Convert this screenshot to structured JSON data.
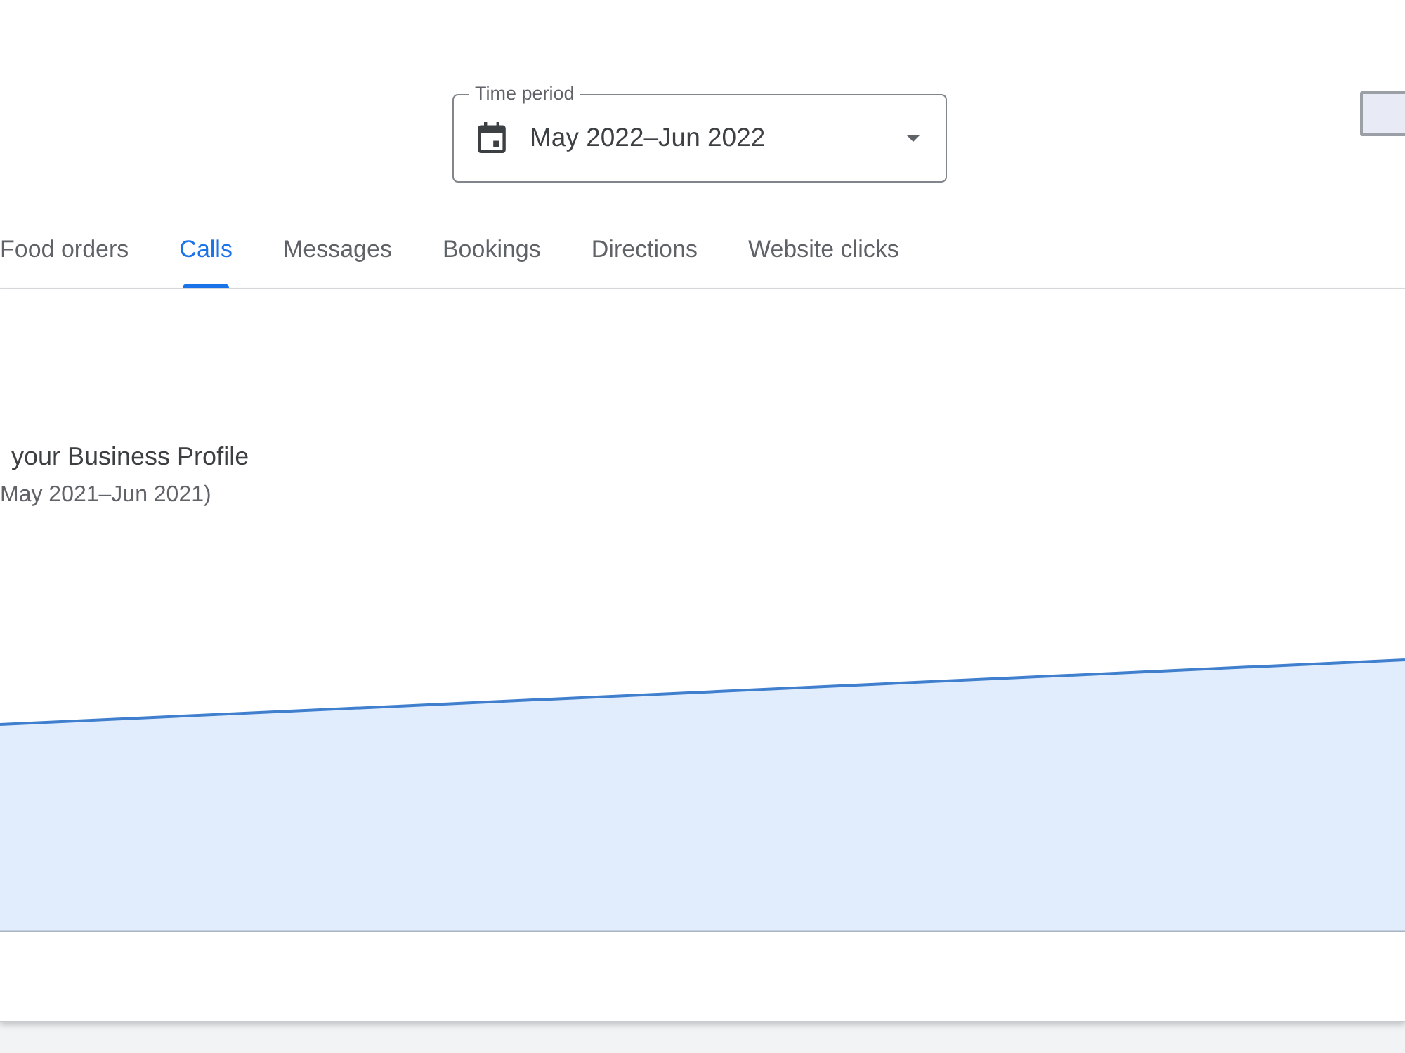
{
  "time_period": {
    "label": "Time period",
    "value": "May 2022–Jun 2022"
  },
  "tabs": [
    {
      "label": "Food orders",
      "selected": false
    },
    {
      "label": "Calls",
      "selected": true
    },
    {
      "label": "Messages",
      "selected": false
    },
    {
      "label": "Bookings",
      "selected": false
    },
    {
      "label": "Directions",
      "selected": false
    },
    {
      "label": "Website clicks",
      "selected": false
    }
  ],
  "chart_panel": {
    "caption": "your Business Profile",
    "comparison": "May 2021–Jun 2021)"
  }
}
